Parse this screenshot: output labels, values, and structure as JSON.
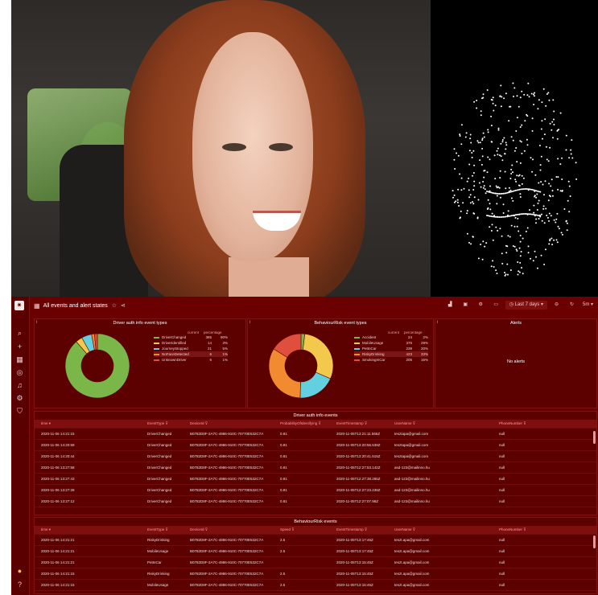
{
  "header": {
    "title": "All events and alert states"
  },
  "toolbar": {
    "time_range": "Last 7 days"
  },
  "panels": {
    "driver_auth": {
      "title": "Driver auth info event types",
      "legend_headers": [
        "current",
        "percentage"
      ],
      "items": [
        {
          "name": "DriverChanged",
          "current": "365",
          "pct": "90%",
          "color": "#7ab648"
        },
        {
          "name": "DriverIdentified",
          "current": "14",
          "pct": "3%",
          "color": "#f2c94c"
        },
        {
          "name": "JourneyStopped",
          "current": "21",
          "pct": "5%",
          "color": "#62d0de"
        },
        {
          "name": "NoFaceDetected",
          "current": "6",
          "pct": "1%",
          "color": "#f28a30"
        },
        {
          "name": "UnknownDriver",
          "current": "6",
          "pct": "1%",
          "color": "#e04f3d"
        }
      ]
    },
    "behaviour": {
      "title": "BehaviourRisk event types",
      "legend_headers": [
        "current",
        "percentage"
      ],
      "items": [
        {
          "name": "Accident",
          "current": "24",
          "pct": "2%",
          "color": "#7ab648"
        },
        {
          "name": "MobileUsage",
          "current": "376",
          "pct": "29%",
          "color": "#f2c94c"
        },
        {
          "name": "PetInCar",
          "current": "239",
          "pct": "20%",
          "color": "#62d0de"
        },
        {
          "name": "RiskyDrinking",
          "current": "423",
          "pct": "33%",
          "color": "#f28a30"
        },
        {
          "name": "SmokingInCar",
          "current": "205",
          "pct": "16%",
          "color": "#e04f3d"
        }
      ]
    },
    "alerts": {
      "title": "Alerts",
      "empty_text": "No alerts"
    }
  },
  "driver_table": {
    "title": "Driver auth info events",
    "columns": [
      "time",
      "EventType",
      "DeviceId",
      "ProbabilityOfIdentifying",
      "EventTimestamp",
      "UserName",
      "PhoneNumber"
    ],
    "rows": [
      [
        "2020-11-06 14:21:15",
        "DriverChanged",
        "B0782D8F-2A7C-4986-910C-70770E532C7A",
        "0.81",
        "2020-11-05T13:21:11.566Z",
        "tesztapa@gmail.com",
        "null"
      ],
      [
        "2020-11-06 14:20:59",
        "DriverChanged",
        "B0782D8F-2A7C-4986-910C-70770E532C7A",
        "0.81",
        "2020-11-05T13:20:56.538Z",
        "tesztapa@gmail.com",
        "null"
      ],
      [
        "2020-11-06 14:20:44",
        "DriverChanged",
        "B0782D8F-2A7C-4986-910C-70770E532C7A",
        "0.81",
        "2020-11-05T13:20:41.515Z",
        "tesztapa@gmail.com",
        "null"
      ],
      [
        "2020-11-06 13:27:58",
        "DriverChanged",
        "B0782D8F-2A7C-4986-910C-70770E532C7A",
        "0.81",
        "2020-11-05T12:27:53.142Z",
        "asd-123@mailinno.hu",
        "null"
      ],
      [
        "2020-11-06 13:27:43",
        "DriverChanged",
        "B0782D8F-2A7C-4986-910C-70770E532C7A",
        "0.81",
        "2020-11-05T12:27:38.285Z",
        "asd-123@mailinno.hu",
        "null"
      ],
      [
        "2020-11-06 13:27:28",
        "DriverChanged",
        "B0782D8F-2A7C-4986-910C-70770E532C7A",
        "0.81",
        "2020-11-05T12:27:23.238Z",
        "asd-123@mailinno.hu",
        "null"
      ],
      [
        "2020-11-06 13:27:12",
        "DriverChanged",
        "B0782D8F-2A7C-4986-910C-70770E532C7A",
        "0.81",
        "2020-11-05T12:27:07.98Z",
        "asd-123@mailinno.hu",
        "null"
      ]
    ]
  },
  "behaviour_table": {
    "title": "BehaviourRisk events",
    "columns": [
      "time",
      "EventType",
      "DeviceId",
      "Speed",
      "EventTimestamp",
      "UserName",
      "PhoneNumber"
    ],
    "rows": [
      [
        "2020-11-06 14:21:21",
        "RiskyDrinking",
        "B0782D8F-2A7C-4986-910C-70770E532C7A",
        "2.5",
        "2020-11-05T13:17:45Z",
        "teszt.apa@gmail.com",
        "null"
      ],
      [
        "2020-11-06 14:21:21",
        "MobileUsage",
        "B0782D8F-2A7C-4986-910C-70770E532C7A",
        "2.5",
        "2020-11-05T13:17:45Z",
        "teszt.apa@gmail.com",
        "null"
      ],
      [
        "2020-11-06 14:21:21",
        "PetInCar",
        "B0782D8F-2A7C-4986-910C-70770E532C7A",
        "",
        "2020-11-05T13:15:45Z",
        "teszt.apa@gmail.com",
        "null"
      ],
      [
        "2020-11-06 14:21:15",
        "RiskyDrinking",
        "B0782D8F-2A7C-4986-910C-70770E532C7A",
        "2.5",
        "2020-11-05T13:15:45Z",
        "teszt.apa@gmail.com",
        "null"
      ],
      [
        "2020-11-06 14:21:15",
        "MobileUsage",
        "B0782D8F-2A7C-4986-910C-70770E532C7A",
        "2.5",
        "2020-11-05T13:15:45Z",
        "teszt.apa@gmail.com",
        "null"
      ]
    ]
  }
}
